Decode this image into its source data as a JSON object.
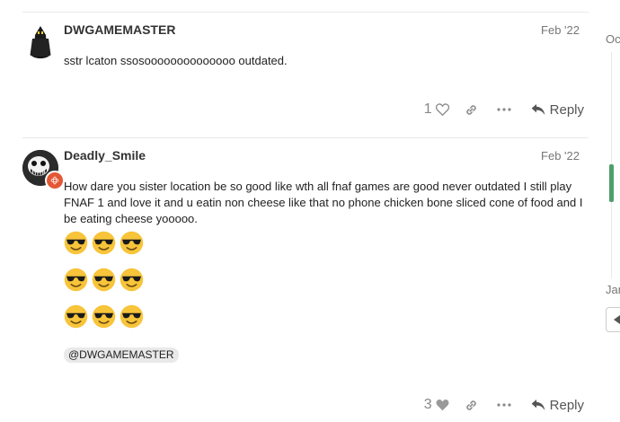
{
  "posts": [
    {
      "username": "DWGAMEMASTER",
      "date": "Feb '22",
      "text": "sstr lcaton ssosoooooooooooooo outdated.",
      "likes": "1",
      "reply_label": "Reply"
    },
    {
      "username": "Deadly_Smile",
      "date": "Feb '22",
      "text": "How dare you sister location be so good like wth all fnaf games are good never outdated I still play FNAF 1 and love it and u eatin non cheese like that no phone chicken bone sliced cone of food and I be eating cheese yooooo.",
      "emoji": "sunglasses-emoji",
      "emoji_rows": 3,
      "emoji_per_row": 3,
      "mention": "@DWGAMEMASTER",
      "likes": "3",
      "reply_label": "Reply"
    }
  ],
  "timeline": {
    "top_label": "Oc",
    "bottom_label": "Jan"
  },
  "colors": {
    "accent_green": "#4f9e6b",
    "badge_red": "#e45735"
  }
}
